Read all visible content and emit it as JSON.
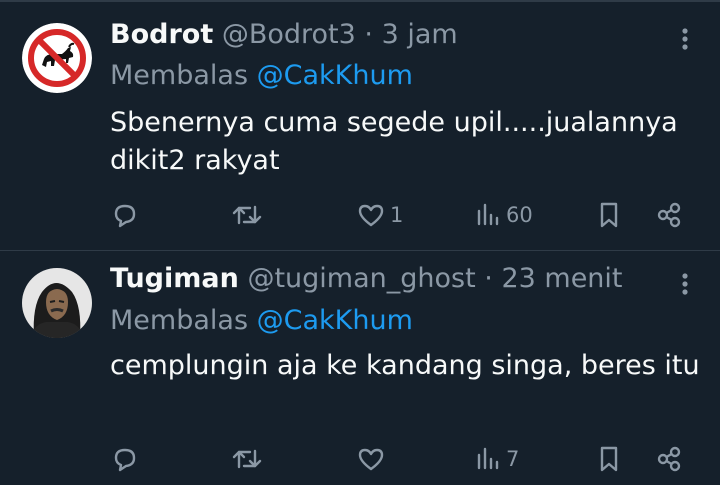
{
  "tweets": [
    {
      "name": "Bodrot",
      "handle": "@Bodrot3",
      "separator": "·",
      "time": "3 jam",
      "reply_prefix": "Membalas",
      "reply_to": "@CakKhum",
      "text": "Sbenernya cuma segede upil.....jualannya dikit2 rakyat",
      "likes": "1",
      "views": "60",
      "avatar_icon": "no-bull-sign-icon"
    },
    {
      "name": "Tugiman",
      "handle": "@tugiman_ghost",
      "separator": "·",
      "time": "23 menit",
      "reply_prefix": "Membalas",
      "reply_to": "@CakKhum",
      "text": "cemplungin aja ke kandang singa, beres itu",
      "likes": "",
      "views": "7",
      "avatar_icon": "hooded-man-portrait"
    }
  ],
  "colors": {
    "background": "#15202b",
    "text": "#f7f9f9",
    "secondary": "#8b98a5",
    "mention": "#1d9bf0",
    "divider": "#2f3b47"
  }
}
